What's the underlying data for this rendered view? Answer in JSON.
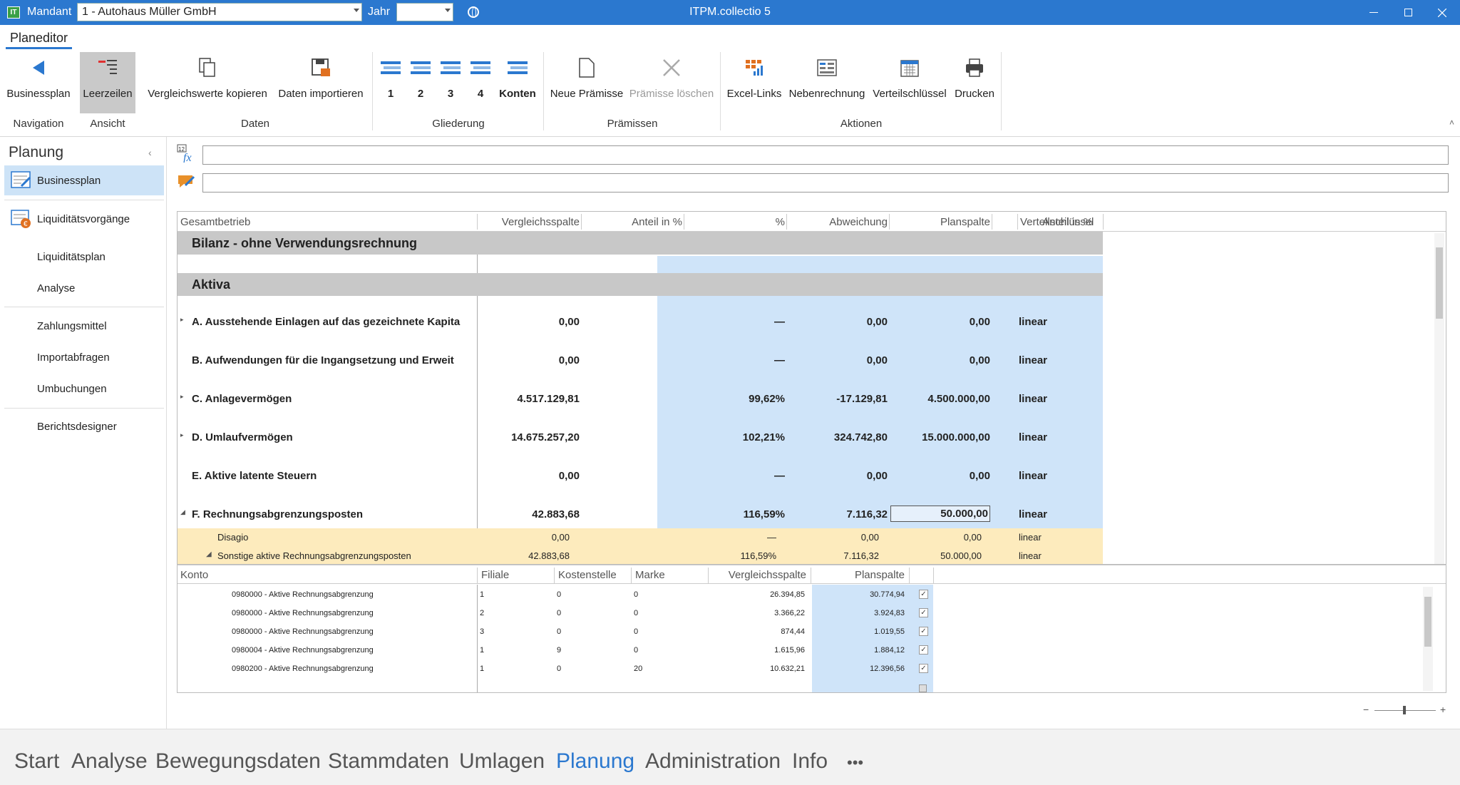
{
  "titlebar": {
    "mandant_label": "Mandant",
    "mandant_value": "1 - Autohaus Müller GmbH",
    "jahr_label": "Jahr",
    "jahr_value": "",
    "app_title": "ITPM.collectio 5",
    "app_icon_text": "IT"
  },
  "ribbon": {
    "tab": "Planeditor",
    "buttons": {
      "businessplan": "Businessplan",
      "leerzeilen": "Leerzeilen",
      "vergleichswerte": "Vergleichswerte kopieren",
      "importieren": "Daten importieren",
      "g1": "1",
      "g2": "2",
      "g3": "3",
      "g4": "4",
      "konten": "Konten",
      "neue_praemisse": "Neue Prämisse",
      "praemisse_loeschen": "Prämisse löschen",
      "excel_links": "Excel-Links",
      "nebenrechnung": "Nebenrechnung",
      "verteilschluessel": "Verteilschlüssel",
      "drucken": "Drucken"
    },
    "groups": {
      "navigation": "Navigation",
      "ansicht": "Ansicht",
      "daten": "Daten",
      "gliederung": "Gliederung",
      "praemissen": "Prämissen",
      "aktionen": "Aktionen"
    }
  },
  "sidebar": {
    "title": "Planung",
    "items": [
      "Businessplan",
      "Liquiditätsvorgänge"
    ],
    "subitems": [
      "Liquiditätsplan",
      "Analyse",
      "Zahlungsmittel",
      "Importabfragen",
      "Umbuchungen",
      "Berichtsdesigner"
    ]
  },
  "grid": {
    "columns": [
      "Gesamtbetrieb",
      "Vergleichsspalte",
      "Anteil in %",
      "%",
      "Abweichung",
      "Planspalte",
      "Anteil in %",
      "Verteilschlüssel"
    ],
    "section1": "Bilanz - ohne Verwendungsrechnung",
    "section2": "Aktiva",
    "rows": [
      {
        "name": "A. Ausstehende Einlagen auf das gezeichnete Kapita",
        "v": "0,00",
        "p": "—",
        "a": "0,00",
        "pl": "0,00",
        "vs": "linear"
      },
      {
        "name": "B. Aufwendungen für die Ingangsetzung und Erweit",
        "v": "0,00",
        "p": "—",
        "a": "0,00",
        "pl": "0,00",
        "vs": "linear"
      },
      {
        "name": "C. Anlagevermögen",
        "v": "4.517.129,81",
        "p": "99,62%",
        "a": "-17.129,81",
        "pl": "4.500.000,00",
        "vs": "linear"
      },
      {
        "name": "D. Umlaufvermögen",
        "v": "14.675.257,20",
        "p": "102,21%",
        "a": "324.742,80",
        "pl": "15.000.000,00",
        "vs": "linear"
      },
      {
        "name": "E. Aktive latente Steuern",
        "v": "0,00",
        "p": "—",
        "a": "0,00",
        "pl": "0,00",
        "vs": "linear"
      },
      {
        "name": "F. Rechnungsabgrenzungsposten",
        "v": "42.883,68",
        "p": "116,59%",
        "a": "7.116,32",
        "pl": "50.000,00",
        "vs": "linear"
      }
    ],
    "subrows": [
      {
        "name": "Disagio",
        "v": "0,00",
        "p": "—",
        "a": "0,00",
        "pl": "0,00",
        "vs": "linear"
      },
      {
        "name": "Sonstige aktive Rechnungsabgrenzungsposten",
        "v": "42.883,68",
        "p": "116,59%",
        "a": "7.116,32",
        "pl": "50.000,00",
        "vs": "linear"
      }
    ]
  },
  "subgrid": {
    "columns": [
      "Konto",
      "Filiale",
      "Kostenstelle",
      "Marke",
      "Vergleichsspalte",
      "Planspalte"
    ],
    "rows": [
      {
        "konto": "0980000 - Aktive Rechnungsabgrenzung",
        "filiale": "1",
        "kst": "0",
        "marke": "0",
        "v": "26.394,85",
        "p": "30.774,94",
        "check": "✓"
      },
      {
        "konto": "0980000 - Aktive Rechnungsabgrenzung",
        "filiale": "2",
        "kst": "0",
        "marke": "0",
        "v": "3.366,22",
        "p": "3.924,83",
        "check": "✓"
      },
      {
        "konto": "0980000 - Aktive Rechnungsabgrenzung",
        "filiale": "3",
        "kst": "0",
        "marke": "0",
        "v": "874,44",
        "p": "1.019,55",
        "check": "✓"
      },
      {
        "konto": "0980004 - Aktive Rechnungsabgrenzung",
        "filiale": "1",
        "kst": "9",
        "marke": "0",
        "v": "1.615,96",
        "p": "1.884,12",
        "check": "✓"
      },
      {
        "konto": "0980200 - Aktive Rechnungsabgrenzung",
        "filiale": "1",
        "kst": "0",
        "marke": "20",
        "v": "10.632,21",
        "p": "12.396,56",
        "check": "✓"
      }
    ]
  },
  "bottom_nav": [
    "Start",
    "Analyse",
    "Bewegungsdaten",
    "Stammdaten",
    "Umlagen",
    "Planung",
    "Administration",
    "Info",
    "•••"
  ],
  "colors": {
    "accent": "#2b78cf",
    "section_bg": "#c8c8c8",
    "plan_bg": "#cfe4f9",
    "highlight_bg": "#fdebbd"
  }
}
